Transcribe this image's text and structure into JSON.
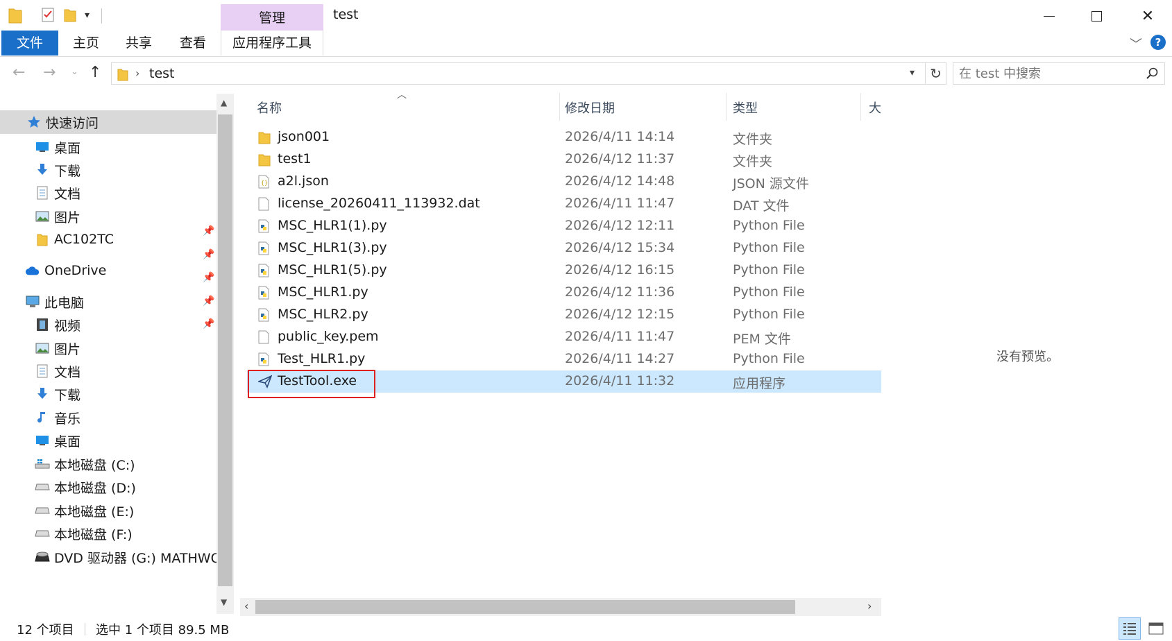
{
  "window": {
    "title": "test",
    "manage_tab": "管理"
  },
  "ribbon": {
    "tabs": [
      "文件",
      "主页",
      "共享",
      "查看",
      "应用程序工具"
    ],
    "help": "?"
  },
  "address": {
    "path": "test",
    "search_placeholder": "在 test 中搜索"
  },
  "nav": {
    "quick_access": "快速访问",
    "quick_items": [
      "桌面",
      "下载",
      "文档",
      "图片",
      "AC102TC"
    ],
    "onedrive": "OneDrive",
    "this_pc": "此电脑",
    "pc_items": [
      "视频",
      "图片",
      "文档",
      "下载",
      "音乐",
      "桌面",
      "本地磁盘 (C:)",
      "本地磁盘 (D:)",
      "本地磁盘 (E:)",
      "本地磁盘 (F:)",
      "DVD 驱动器 (G:) MATHWORKS"
    ]
  },
  "columns": {
    "name": "名称",
    "date": "修改日期",
    "type": "类型",
    "size": "大"
  },
  "files": [
    {
      "name": "json001",
      "date": "2026/4/11 14:14",
      "type": "文件夹",
      "icon": "folder-icon"
    },
    {
      "name": "test1",
      "date": "2026/4/12 11:37",
      "type": "文件夹",
      "icon": "folder-icon"
    },
    {
      "name": "a2l.json",
      "date": "2026/4/12 14:48",
      "type": "JSON 源文件",
      "icon": "json-file-icon"
    },
    {
      "name": "license_20260411_113932.dat",
      "date": "2026/4/11 11:47",
      "type": "DAT 文件",
      "icon": "blank-file-icon"
    },
    {
      "name": "MSC_HLR1(1).py",
      "date": "2026/4/12 12:11",
      "type": "Python File",
      "icon": "python-file-icon"
    },
    {
      "name": "MSC_HLR1(3).py",
      "date": "2026/4/12 15:34",
      "type": "Python File",
      "icon": "python-file-icon"
    },
    {
      "name": "MSC_HLR1(5).py",
      "date": "2026/4/12 16:15",
      "type": "Python File",
      "icon": "python-file-icon"
    },
    {
      "name": "MSC_HLR1.py",
      "date": "2026/4/12 11:36",
      "type": "Python File",
      "icon": "python-file-icon"
    },
    {
      "name": "MSC_HLR2.py",
      "date": "2026/4/12 12:15",
      "type": "Python File",
      "icon": "python-file-icon"
    },
    {
      "name": "public_key.pem",
      "date": "2026/4/11 11:47",
      "type": "PEM 文件",
      "icon": "blank-file-icon"
    },
    {
      "name": "Test_HLR1.py",
      "date": "2026/4/11 14:27",
      "type": "Python File",
      "icon": "python-file-icon"
    },
    {
      "name": "TestTool.exe",
      "date": "2026/4/11 11:32",
      "type": "应用程序",
      "icon": "app-exe-icon",
      "selected": true
    }
  ],
  "preview": {
    "empty_text": "没有预览。"
  },
  "status": {
    "count": "12 个项目",
    "selection": "选中 1 个项目  89.5 MB"
  },
  "colors": {
    "accent": "#1a6fc9",
    "manage_tab_bg": "#e8d0f5",
    "selection_bg": "#cce8ff",
    "highlight_border": "#e02020",
    "folder": "#f4c542"
  }
}
